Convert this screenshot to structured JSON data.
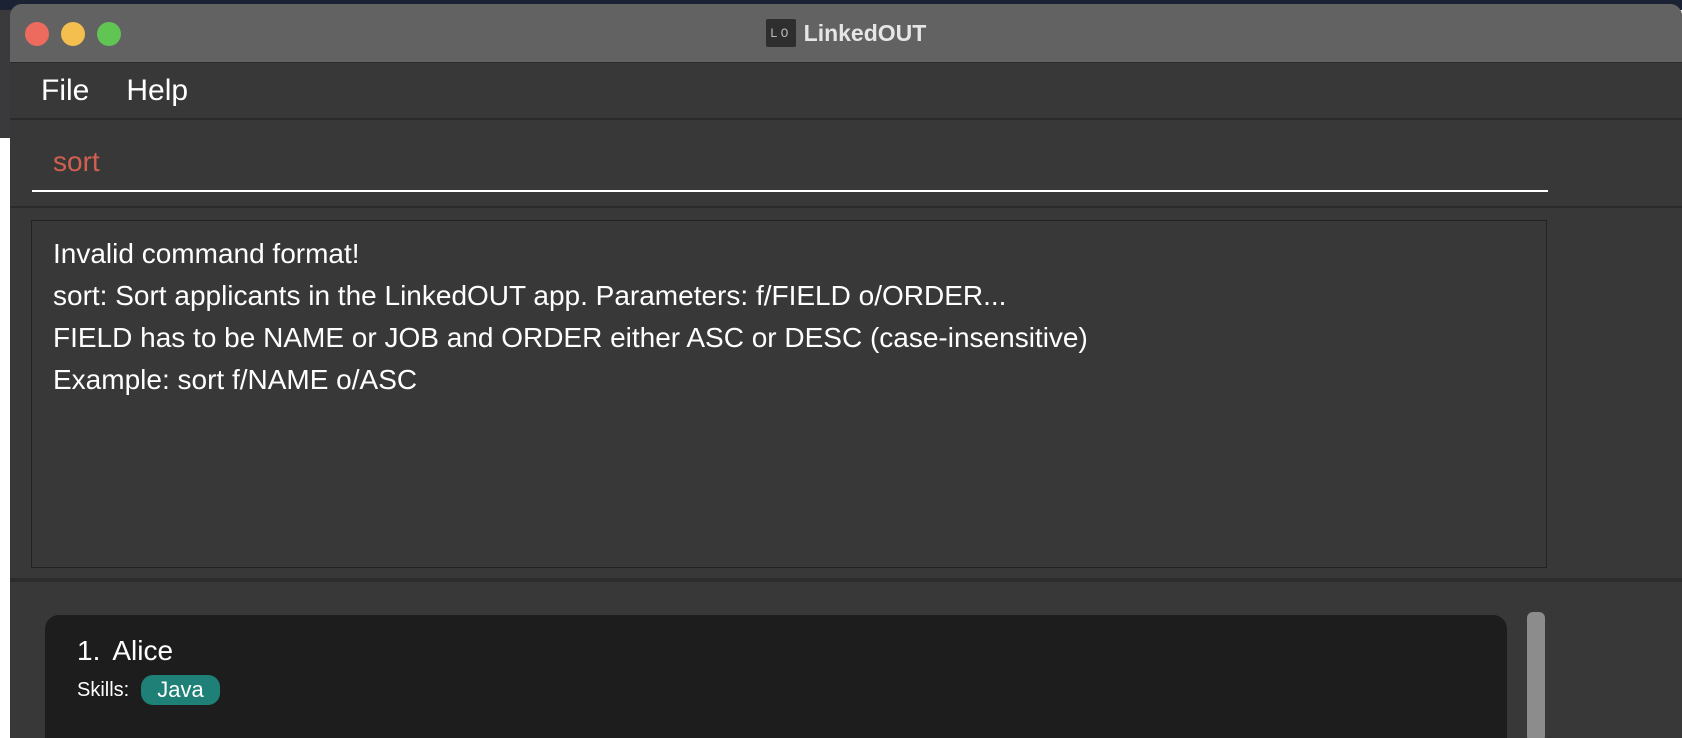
{
  "window": {
    "title": "LinkedOUT",
    "app_icon_text": "LO"
  },
  "menu": {
    "items": [
      {
        "label": "File"
      },
      {
        "label": "Help"
      }
    ]
  },
  "command_box": {
    "value": "sort"
  },
  "result_display": {
    "lines": [
      "Invalid command format!",
      "sort: Sort applicants in the LinkedOUT app. Parameters: f/FIELD o/ORDER...",
      "FIELD has to be NAME or JOB and ORDER either ASC or DESC (case-insensitive)",
      "Example: sort f/NAME o/ASC"
    ]
  },
  "applicants": [
    {
      "index": "1.",
      "name": "Alice",
      "skills_label": "Skills:",
      "skills": [
        "Java"
      ]
    }
  ],
  "colors": {
    "command_text": "#d0604f",
    "skill_tag": "#1f8078",
    "close": "#ed6a5e",
    "minimize": "#f5bf4f",
    "maximize": "#61c554"
  }
}
